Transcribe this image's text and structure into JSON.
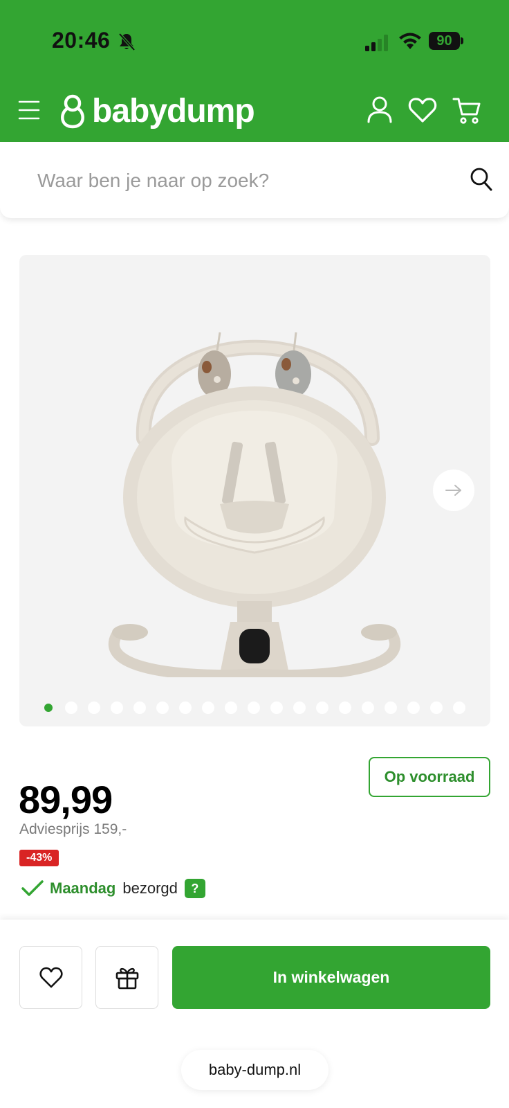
{
  "status_bar": {
    "time": "20:46",
    "battery": "90",
    "icons": [
      "bell-slash-icon",
      "signal-icon",
      "wifi-icon",
      "battery-icon"
    ]
  },
  "header": {
    "brand": "babydump",
    "icons": [
      "menu-icon",
      "logo-icon",
      "user-icon",
      "heart-icon",
      "cart-icon"
    ],
    "background": "#33a532"
  },
  "search": {
    "placeholder": "Waar ben je naar op zoek?",
    "value": ""
  },
  "gallery": {
    "image_count": 19,
    "active_index": 0,
    "image_alt": "baby swing product photo"
  },
  "product": {
    "price": "89,99",
    "advice_price": "Adviesprijs 159,-",
    "discount": "-43%",
    "stock": "Op voorraad",
    "delivery_day": "Maandag",
    "delivery_text": "bezorgd",
    "help": "?"
  },
  "actions": {
    "add_to_cart": "In winkelwagen"
  },
  "browser": {
    "url": "baby-dump.nl"
  },
  "colors": {
    "accent": "#33a532",
    "accent_dark": "#2e8f2d",
    "discount": "#d92424"
  }
}
